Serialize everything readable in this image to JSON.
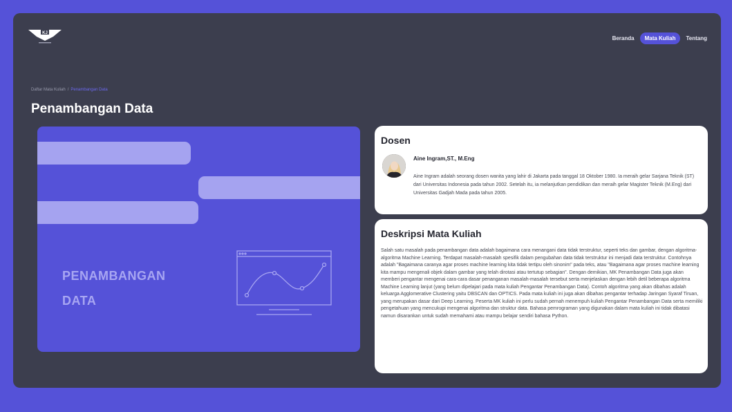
{
  "header": {
    "logo_text": "KJ",
    "nav": [
      {
        "label": "Beranda",
        "active": false
      },
      {
        "label": "Mata Kuliah",
        "active": true
      },
      {
        "label": "Tentang",
        "active": false
      }
    ]
  },
  "breadcrumb": {
    "parent": "Daftar Mata Kuliah",
    "separator": "/",
    "current": "Penambangan Data"
  },
  "page_title": "Penambangan Data",
  "hero": {
    "line1": "PENAMBANGAN",
    "line2": "DATA"
  },
  "dosen": {
    "heading": "Dosen",
    "name": "Aine Ingram,ST., M.Eng",
    "bio": "Aine Ingram adalah seorang dosen wanita yang lahir di Jakarta pada tanggal 18 Oktober 1980. Ia meraih gelar Sarjana Teknik (ST) dari Universitas Indonesia pada tahun 2002. Setelah itu, ia melanjutkan pendidikan dan meraih gelar Magister Teknik (M.Eng) dari Universitas Gadjah Mada pada tahun 2005."
  },
  "deskripsi": {
    "heading": "Deskripsi Mata Kuliah",
    "text": "Salah satu masalah pada penambangan data adalah bagaimana cara menangani data tidak terstruktur, seperti teks dan gambar, dengan algoritma-algoritma Machine Learning. Terdapat masalah-masalah spesifik dalam pengubahan data tidak terstruktur ini menjadi data terstruktur. Contohnya adalah \"Bagaimana caranya agar proses machine learning kita tidak tertipu oleh sinonim\" pada teks, atau \"Bagaimana agar proses machine learning kita mampu mengenali objek dalam gambar yang telah dirotasi atau tertutup sebagian\". Dengan demikian, MK Penambangan Data juga akan memberi pengantar mengenai cara-cara dasar penanganan masalah-masalah tersebut serta menjelaskan dengan lebih detil beberapa algoritma Machine Learning lanjut (yang belum dipelajari pada mata kuliah Pengantar Penambangan Data). Contoh algoritma yang akan dibahas adalah keluarga Agglomerative Clustering yaitu DBSCAN dan OPTICS. Pada mata kuliah ini juga akan dibahas pengantar terhadap Jaringan Syaraf Tiruan, yang merupakan dasar dari Deep Learning. Peserta MK kuliah ini perlu sudah pernah menempuh kuliah Pengantar Penambangan Data serta memiliki pengetahuan yang mencukupi mengenai algoritma dan struktur data. Bahasa pemrograman yang digunakan dalam mata kuliah ini tidak dibatasi namun disarankan untuk sudah memahami atau mampu belajar sendiri bahasa Python."
  },
  "colors": {
    "accent": "#5552d8",
    "frame_bg": "#3c3e4e",
    "hero_bar": "#a5a3f0"
  }
}
